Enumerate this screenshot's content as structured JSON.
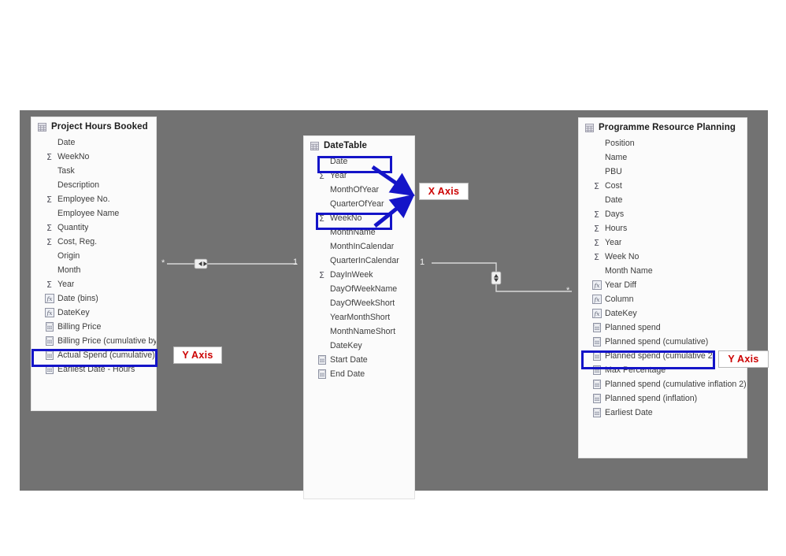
{
  "canvas": {
    "background_color": "#727272",
    "page_background": "#ffffff"
  },
  "tables": [
    {
      "name": "Project Hours Booked",
      "icon": "table-icon",
      "fields": [
        {
          "label": "Date",
          "icon": "none"
        },
        {
          "label": "WeekNo",
          "icon": "sigma"
        },
        {
          "label": "Task",
          "icon": "none"
        },
        {
          "label": "Description",
          "icon": "none"
        },
        {
          "label": "Employee No.",
          "icon": "sigma"
        },
        {
          "label": "Employee Name",
          "icon": "none"
        },
        {
          "label": "Quantity",
          "icon": "sigma"
        },
        {
          "label": "Cost, Reg.",
          "icon": "sigma"
        },
        {
          "label": "Origin",
          "icon": "none"
        },
        {
          "label": "Month",
          "icon": "none"
        },
        {
          "label": "Year",
          "icon": "sigma"
        },
        {
          "label": "Date (bins)",
          "icon": "fx"
        },
        {
          "label": "DateKey",
          "icon": "fx"
        },
        {
          "label": "Billing Price",
          "icon": "measure"
        },
        {
          "label": "Billing Price (cumulative by »",
          "icon": "measure"
        },
        {
          "label": "Actual Spend (cumulative)",
          "icon": "measure"
        },
        {
          "label": "Earliest Date - Hours",
          "icon": "measure"
        }
      ]
    },
    {
      "name": "DateTable",
      "icon": "table-icon",
      "fields": [
        {
          "label": "Date",
          "icon": "none"
        },
        {
          "label": "Year",
          "icon": "sigma"
        },
        {
          "label": "MonthOfYear",
          "icon": "none"
        },
        {
          "label": "QuarterOfYear",
          "icon": "none"
        },
        {
          "label": "WeekNo",
          "icon": "sigma"
        },
        {
          "label": "MonthName",
          "icon": "none"
        },
        {
          "label": "MonthInCalendar",
          "icon": "none"
        },
        {
          "label": "QuarterInCalendar",
          "icon": "none"
        },
        {
          "label": "DayInWeek",
          "icon": "sigma"
        },
        {
          "label": "DayOfWeekName",
          "icon": "none"
        },
        {
          "label": "DayOfWeekShort",
          "icon": "none"
        },
        {
          "label": "YearMonthShort",
          "icon": "none"
        },
        {
          "label": "MonthNameShort",
          "icon": "none"
        },
        {
          "label": "DateKey",
          "icon": "none"
        },
        {
          "label": "Start Date",
          "icon": "measure"
        },
        {
          "label": "End Date",
          "icon": "measure"
        }
      ]
    },
    {
      "name": "Programme Resource Planning",
      "icon": "table-icon",
      "fields": [
        {
          "label": "Position",
          "icon": "none"
        },
        {
          "label": "Name",
          "icon": "none"
        },
        {
          "label": "PBU",
          "icon": "none"
        },
        {
          "label": "Cost",
          "icon": "sigma"
        },
        {
          "label": "Date",
          "icon": "none"
        },
        {
          "label": "Days",
          "icon": "sigma"
        },
        {
          "label": "Hours",
          "icon": "sigma"
        },
        {
          "label": "Year",
          "icon": "sigma"
        },
        {
          "label": "Week No",
          "icon": "sigma"
        },
        {
          "label": "Month Name",
          "icon": "none"
        },
        {
          "label": "Year Diff",
          "icon": "fx"
        },
        {
          "label": "Column",
          "icon": "fx"
        },
        {
          "label": "DateKey",
          "icon": "fx"
        },
        {
          "label": "Planned spend",
          "icon": "measure"
        },
        {
          "label": "Planned spend (cumulative)",
          "icon": "measure"
        },
        {
          "label": "Planned spend (cumulative 2)",
          "icon": "measure"
        },
        {
          "label": "Max Percentage",
          "icon": "measure"
        },
        {
          "label": "Planned spend (cumulative inflation 2)",
          "icon": "measure"
        },
        {
          "label": "Planned spend (inflation)",
          "icon": "measure"
        },
        {
          "label": "Earliest Date",
          "icon": "measure"
        }
      ]
    }
  ],
  "highlights": [
    {
      "target": "Actual Spend (cumulative)",
      "color": "#1414c8"
    },
    {
      "target": "Date",
      "color": "#1414c8"
    },
    {
      "target": "WeekNo",
      "color": "#1414c8"
    },
    {
      "target": "Planned spend (cumulative 2)",
      "color": "#1414c8"
    }
  ],
  "callouts": [
    {
      "label": "Y Axis",
      "for": "Actual Spend (cumulative)",
      "color": "#cc0000"
    },
    {
      "label": "X Axis",
      "for": "Date / WeekNo",
      "color": "#cc0000"
    },
    {
      "label": "Y Axis",
      "for": "Planned spend (cumulative 2)",
      "color": "#cc0000"
    }
  ],
  "relationships": [
    {
      "from_table": "Project Hours Booked",
      "to_table": "DateTable",
      "from_cardinality": "*",
      "to_cardinality": "1",
      "cross_filter": "both"
    },
    {
      "from_table": "DateTable",
      "to_table": "Programme Resource Planning",
      "from_cardinality": "1",
      "to_cardinality": "*",
      "cross_filter": "both"
    }
  ]
}
